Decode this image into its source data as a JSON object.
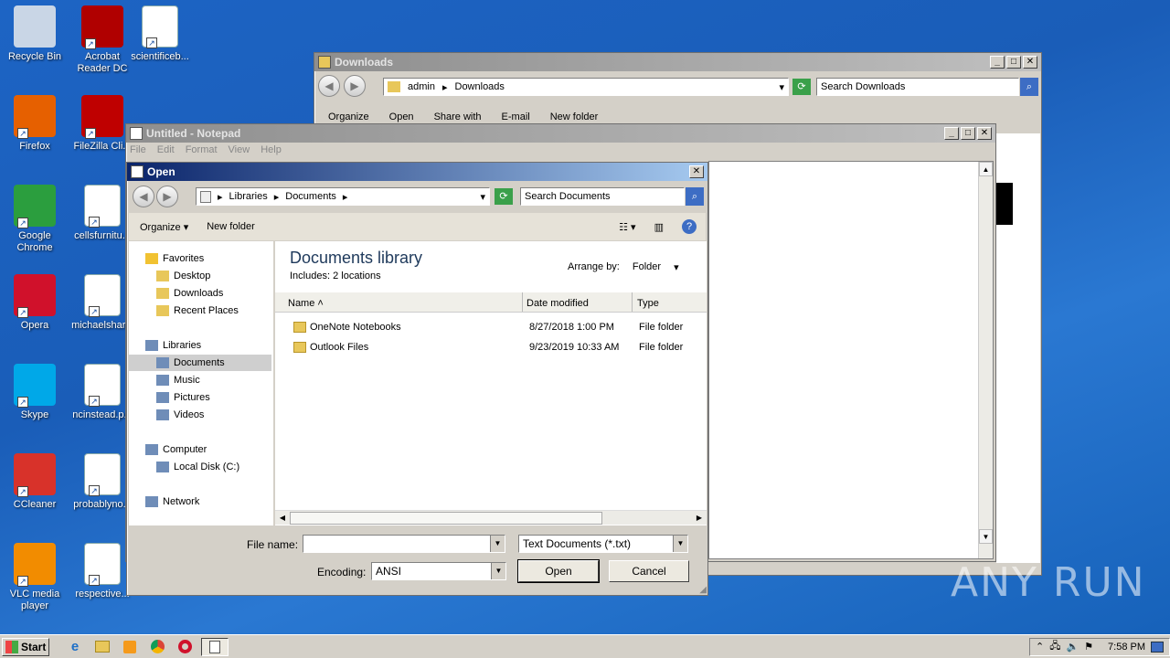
{
  "desktop": {
    "icons": [
      {
        "label": "Recycle Bin",
        "color": "#c9d6e6"
      },
      {
        "label": "Acrobat\nReader DC",
        "color": "#b00000"
      },
      {
        "label": "scientificeb...",
        "color": "#ffffff"
      },
      {
        "label": "Firefox",
        "color": "#e66000"
      },
      {
        "label": "FileZilla Cli...",
        "color": "#bf0000"
      },
      {
        "label": "Google\nChrome",
        "color": "#2b9e3e"
      },
      {
        "label": "cellsfurnitu...",
        "color": "#ffffff"
      },
      {
        "label": "Opera",
        "color": "#d0112b"
      },
      {
        "label": "michaelshar...",
        "color": "#ffffff"
      },
      {
        "label": "Skype",
        "color": "#00a8e8"
      },
      {
        "label": "ncinstead.p...",
        "color": "#ffffff"
      },
      {
        "label": "CCleaner",
        "color": "#d8322a"
      },
      {
        "label": "probablyno...",
        "color": "#ffffff"
      },
      {
        "label": "VLC media\nplayer",
        "color": "#f28c00"
      },
      {
        "label": "respective...",
        "color": "#ffffff"
      }
    ]
  },
  "downloads_window": {
    "title": "Downloads",
    "path": [
      "admin",
      "Downloads"
    ],
    "search_placeholder": "Search Downloads",
    "toolbar": [
      "Organize",
      "Open",
      "Share with",
      "E-mail",
      "New folder"
    ]
  },
  "notepad": {
    "title": "Untitled - Notepad",
    "menu": [
      "File",
      "Edit",
      "Format",
      "View",
      "Help"
    ]
  },
  "open_dialog": {
    "title": "Open",
    "path": [
      "Libraries",
      "Documents"
    ],
    "search_placeholder": "Search Documents",
    "toolbar": {
      "organize": "Organize",
      "new_folder": "New folder"
    },
    "nav": {
      "favorites": "Favorites",
      "favorites_items": [
        "Desktop",
        "Downloads",
        "Recent Places"
      ],
      "libraries": "Libraries",
      "libraries_items": [
        "Documents",
        "Music",
        "Pictures",
        "Videos"
      ],
      "computer": "Computer",
      "computer_items": [
        "Local Disk (C:)"
      ],
      "network": "Network"
    },
    "library_title": "Documents library",
    "library_includes": "Includes:  2 locations",
    "arrange_by_label": "Arrange by:",
    "arrange_by_value": "Folder",
    "columns": [
      "Name",
      "Date modified",
      "Type"
    ],
    "files": [
      {
        "name": "OneNote Notebooks",
        "date": "8/27/2018 1:00 PM",
        "type": "File folder"
      },
      {
        "name": "Outlook Files",
        "date": "9/23/2019 10:33 AM",
        "type": "File folder"
      }
    ],
    "file_name_label": "File name:",
    "file_name_value": "",
    "filter_value": "Text Documents (*.txt)",
    "encoding_label": "Encoding:",
    "encoding_value": "ANSI",
    "open_label": "Open",
    "cancel_label": "Cancel"
  },
  "taskbar": {
    "start_label": "Start",
    "clock": "7:58 PM"
  },
  "watermark": "ANY RUN"
}
